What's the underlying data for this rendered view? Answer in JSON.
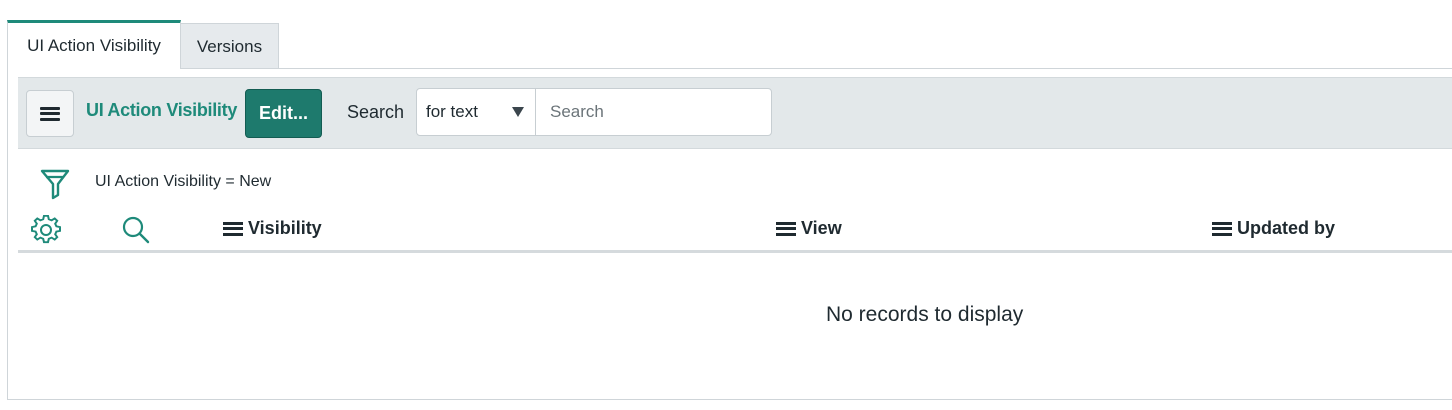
{
  "tabs": [
    {
      "label": "UI Action Visibility",
      "active": true
    },
    {
      "label": "Versions",
      "active": false
    }
  ],
  "toolbar": {
    "menu_icon": "hamburger-menu-icon",
    "list_title": "UI Action Visibility",
    "edit_label": "Edit...",
    "search_label": "Search",
    "search_field": {
      "selected": "for text"
    },
    "search_input": {
      "value": "",
      "placeholder": "Search"
    }
  },
  "filter": {
    "icon": "filter-funnel-icon",
    "text": "UI Action Visibility = New"
  },
  "table": {
    "settings_icon": "gear-icon",
    "search_icon": "search-icon",
    "columns": [
      "Visibility",
      "View",
      "Updated by"
    ],
    "rows": [],
    "empty_message": "No records to display"
  },
  "colors": {
    "accent": "#1e8a7a",
    "edit_button": "#1e7a6d",
    "toolbar_bg": "#e3e8ea"
  }
}
